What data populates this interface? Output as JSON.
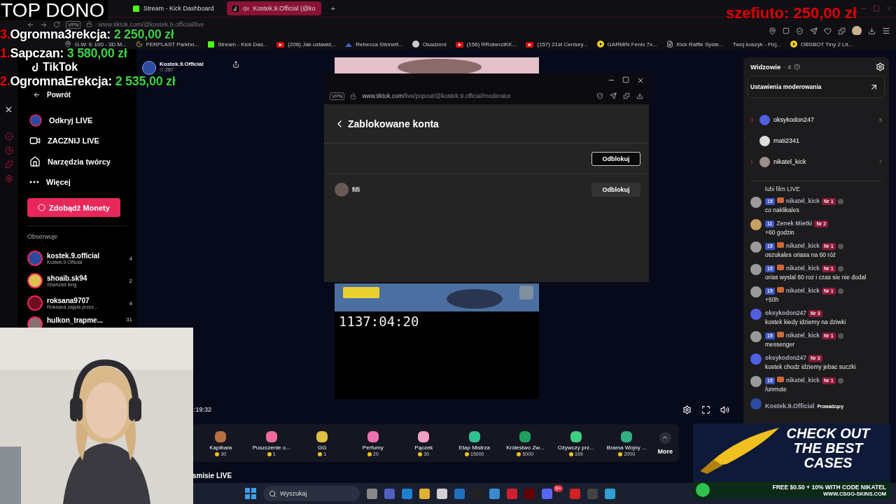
{
  "browser": {
    "tabs": [
      {
        "label": "Stream - Kick Dashboard",
        "kind": "kick",
        "selected": false
      },
      {
        "label": "Kostek.9.Official (@ko",
        "kind": "tiktok",
        "selected": true
      }
    ],
    "new_tab": "+",
    "vpn": "VPN",
    "url": "www.tiktok.com/@kostek.9.official/live",
    "bookmarks": [
      {
        "label": "G.W. E 100 - 3D M...",
        "kind": "pin"
      },
      {
        "label": "FERPLAST Parkho...",
        "kind": "moon"
      },
      {
        "label": "Stream - Kick Das...",
        "kind": "kick"
      },
      {
        "label": "(206) Jak ustawić...",
        "kind": "video"
      },
      {
        "label": "Rebecca Stinnett...",
        "kind": "site"
      },
      {
        "label": "Osadzeni",
        "kind": "circle"
      },
      {
        "label": "(156) RRoberciKK...",
        "kind": "video"
      },
      {
        "label": "(157) 21st Century...",
        "kind": "video"
      },
      {
        "label": "GARMIN Fenix 7x...",
        "kind": "play"
      },
      {
        "label": "Kick Raffle Syste...",
        "kind": "page"
      },
      {
        "label": "Twój koszyk - Fizj...",
        "kind": "none"
      },
      {
        "label": "OBSBOT Tiny 2 Lit...",
        "kind": "play"
      }
    ]
  },
  "sidebar": {
    "back": "Powrót",
    "menu": [
      {
        "label": "Odkryj LIVE",
        "kind": "avatar"
      },
      {
        "label": "ZACZNIJ LIVE",
        "kind": "camera"
      },
      {
        "label": "Narzędzia twórcy",
        "kind": "home"
      },
      {
        "label": "Więcej",
        "kind": "more"
      }
    ],
    "coins_button": "Zdobądź Monety",
    "following_title": "Obserwuje",
    "following": [
      {
        "name": "kostek.9.official",
        "sub": "Kostek.9.Official",
        "count": "4",
        "live": true
      },
      {
        "name": "shoaib.sk94",
        "sub": "Shahzad king",
        "count": "2",
        "live": true
      },
      {
        "name": "roksana9707",
        "sub": "Roksana zajęta przez...",
        "count": "4",
        "live": true
      },
      {
        "name": "hulkon_trapme...",
        "count": "31",
        "live": true
      }
    ]
  },
  "stream": {
    "channel": "Kostek.9.Official",
    "likes": "287",
    "timer": "1137:04:20",
    "elapsed": ":19:32",
    "gifts": [
      {
        "name": "Kapibara",
        "price": "30"
      },
      {
        "name": "Puszczenie o...",
        "price": "1"
      },
      {
        "name": "GG",
        "price": "1"
      },
      {
        "name": "Perfumy",
        "price": "20"
      },
      {
        "name": "Pączek",
        "price": "30"
      },
      {
        "name": "Etap Mistrza",
        "price": "15000"
      },
      {
        "name": "Królestwo Zw...",
        "price": "5000"
      },
      {
        "name": "Ożywczy prz...",
        "price": "199"
      },
      {
        "name": "Brama Wojny ...",
        "price": "2000"
      }
    ],
    "more": "More",
    "below": "smisie LIVE"
  },
  "popup": {
    "vpn": "VPN",
    "url_host": "www.tiktok.com",
    "url_path": "/live/popout/@kostek.9.official/moderator",
    "title": "Zablokowane konta",
    "rows": [
      {
        "button": "Odblokuj",
        "hovered": true
      },
      {
        "name": "fifi",
        "button": "Odblokuj",
        "hovered": false
      }
    ]
  },
  "panel": {
    "title": "Widzowie",
    "count": "· 4",
    "moderation": "Ustawienia moderowania",
    "viewers": [
      {
        "rank": "3",
        "name": "oksykodon247",
        "count": "5"
      },
      {
        "rank": "-",
        "name": "mati2341"
      },
      {
        "rank": "1",
        "name": "nikatel_kick",
        "count": "7"
      }
    ],
    "chat": [
      {
        "kind": "system",
        "text": "lubi film LIVE"
      },
      {
        "kind": "user",
        "user": "nikatel_kick",
        "level": "15",
        "rank": "Nr 1",
        "fan": true,
        "text": "co naklikales"
      },
      {
        "kind": "user",
        "user": "Zenek Mietki",
        "level": "11",
        "rank": "Nr 2",
        "fan": false,
        "text": "+60 godzin"
      },
      {
        "kind": "user",
        "user": "nikatel_kick",
        "level": "15",
        "rank": "Nr 1",
        "fan": true,
        "text": "oszukales oriasa na 60 róż"
      },
      {
        "kind": "user",
        "user": "nikatel_kick",
        "level": "15",
        "rank": "Nr 1",
        "fan": true,
        "text": "orias wyslal 60 roz i czas sie nie dodal"
      },
      {
        "kind": "user",
        "user": "nikatel_kick",
        "level": "15",
        "rank": "Nr 1",
        "fan": true,
        "text": "+50h"
      },
      {
        "kind": "user",
        "user": "oksykodon247",
        "rank": "Nr 3",
        "fan": false,
        "text": "kostek kiedy idziemy na dziwki"
      },
      {
        "kind": "user",
        "user": "nikatel_kick",
        "level": "15",
        "rank": "Nr 1",
        "fan": true,
        "text": "messenger"
      },
      {
        "kind": "user",
        "user": "oksykodon247",
        "rank": "Nr 3",
        "fan": false,
        "text": "kostek chodz idziemy jebac suczki"
      },
      {
        "kind": "user",
        "user": "nikatel_kick",
        "level": "15",
        "rank": "Nr 1",
        "fan": true,
        "text": "/unmute"
      },
      {
        "kind": "host",
        "user": "Kostek.9.Official",
        "role": "Prowadzący"
      }
    ]
  },
  "taskbar": {
    "search": {
      "placeholder": "Wyszukaj"
    },
    "badge": "9+"
  },
  "overlay": {
    "title": "TOP DONO",
    "donors": [
      {
        "rank": "3.",
        "name": "Ogromna3rekcja:",
        "amount": "2 250,00 zł"
      },
      {
        "rank": "1.",
        "name": "Sapczan:",
        "amount": "3 580,00 zł"
      },
      {
        "rank": "2.",
        "name": "OgromnaErekcja:",
        "amount": "2 535,00 zł"
      }
    ],
    "platform": "TikTok",
    "latest": {
      "name": "szefiuto:",
      "amount": "250,00 zł"
    },
    "promo": {
      "headline": "CHECK OUT THE BEST CASES",
      "offer": "FREE $0.50 + 10% WITH CODE NIKATEL",
      "site": "WWW.CSGO-SKINS.COM"
    }
  }
}
